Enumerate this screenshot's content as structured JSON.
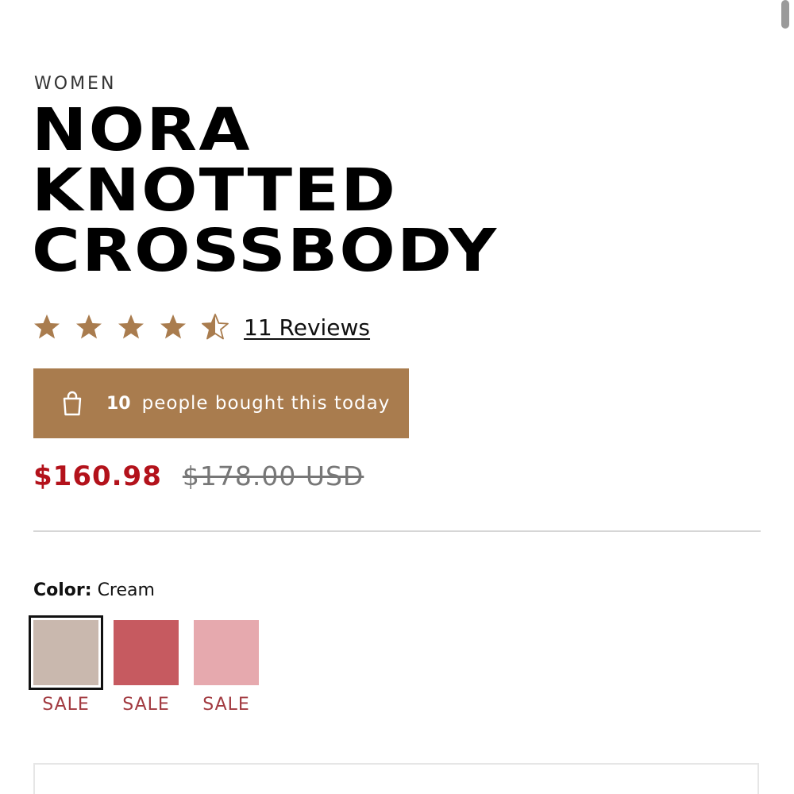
{
  "product": {
    "category": "WOMEN",
    "title_lines": [
      "NORA",
      "KNOTTED",
      "CROSSBODY"
    ]
  },
  "rating": {
    "value": 4.5,
    "max": 5,
    "reviews_label": "11 Reviews",
    "star_color": "#a97c4e"
  },
  "social_proof": {
    "icon": "shopping-bag-icon",
    "count": "10",
    "text": "people bought this today",
    "background": "#a97c4e"
  },
  "pricing": {
    "sale_price": "$160.98",
    "original_price": "$178.00 USD",
    "sale_color": "#b3121b"
  },
  "color_selector": {
    "label": "Color:",
    "selected_value": "Cream",
    "swatches": [
      {
        "color": "#c9b8ae",
        "tag": "SALE",
        "selected": true
      },
      {
        "color": "#c65a60",
        "tag": "SALE",
        "selected": false
      },
      {
        "color": "#e6a9ae",
        "tag": "SALE",
        "selected": false
      }
    ]
  }
}
